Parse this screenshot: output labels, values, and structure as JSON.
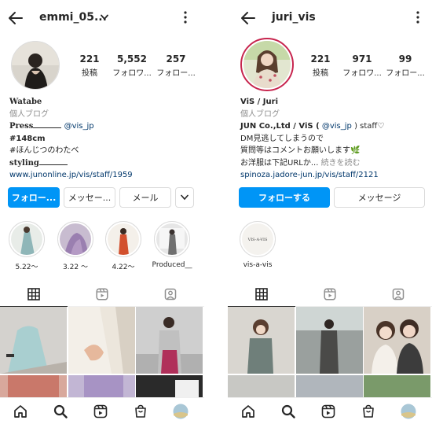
{
  "left": {
    "username": "emmi_05...",
    "stats": [
      {
        "number": "221",
        "label": "投稿"
      },
      {
        "number": "5,552",
        "label": "フォロワ..."
      },
      {
        "number": "257",
        "label": "フォロー..."
      }
    ],
    "bio": {
      "name": "Watabe",
      "category": "個人ブログ",
      "press_label": "Press",
      "press_mention": "@vis_jp",
      "height": "#148cm",
      "tagline": "#ほんじつのわたべ",
      "styling_label": "styling",
      "link": "www.junonline.jp/vis/staff/1959"
    },
    "buttons": {
      "follow": "フォロー...",
      "message": "メッセー...",
      "email": "メール"
    },
    "highlights": [
      {
        "label": "5.22〜"
      },
      {
        "label": "3.22 〜"
      },
      {
        "label": "4.22〜"
      },
      {
        "label": "Produced__"
      }
    ]
  },
  "right": {
    "username": "juri_vis",
    "stats": [
      {
        "number": "221",
        "label": "投稿"
      },
      {
        "number": "971",
        "label": "フォロワ..."
      },
      {
        "number": "99",
        "label": "フォロー..."
      }
    ],
    "bio": {
      "name": "ViS / Juri",
      "category": "個人ブログ",
      "company_prefix": "JUN Co.,Ltd / ViS (",
      "company_mention": "@vis_jp",
      "company_suffix": ") staff♡",
      "line1": "DM見逃してしまうので",
      "line2": "質問等はコメントお願いします🌿",
      "line3": "お洋服は下記URLか...",
      "more": "続きを読む",
      "link": "spinoza.jadore-jun.jp/vis/staff/2121"
    },
    "buttons": {
      "follow": "フォローする",
      "message": "メッセージ"
    },
    "highlights": [
      {
        "label": "vis-a-vis"
      }
    ],
    "highlight_text": "VIS-A-VIS"
  },
  "colors": {
    "primary_button": "#0095f6",
    "link": "#00376b",
    "muted": "#8e8e8e",
    "story_ring": "#c7254e"
  },
  "icons": {
    "back": "arrow-left-icon",
    "more": "more-vertical-icon",
    "dropdown": "chevron-down-icon",
    "grid": "grid-icon",
    "reels": "reels-icon",
    "tagged": "tagged-icon",
    "home": "home-icon",
    "search": "search-icon",
    "shop": "shop-icon"
  }
}
